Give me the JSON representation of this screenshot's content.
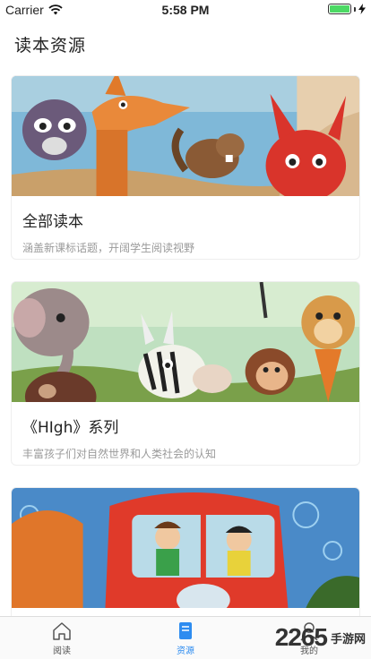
{
  "status_bar": {
    "carrier": "Carrier",
    "time": "5:58 PM",
    "battery_level": 1.0
  },
  "page": {
    "title": "读本资源"
  },
  "cards": [
    {
      "title": "全部读本",
      "subtitle": "涵盖新课标话题，开阔学生阅读视野"
    },
    {
      "title": "《HIgh》系列",
      "subtitle": "丰富孩子们对自然世界和人类社会的认知"
    },
    {
      "title": "",
      "subtitle": ""
    }
  ],
  "tabs": [
    {
      "label": "阅读",
      "icon": "home-icon",
      "active": false
    },
    {
      "label": "资源",
      "icon": "book-icon",
      "active": true
    },
    {
      "label": "我的",
      "icon": "user-icon",
      "active": false
    }
  ],
  "watermark": {
    "number": "2265",
    "text": "手游网"
  },
  "colors": {
    "accent": "#2d8cf0",
    "battery": "#4cd964"
  }
}
